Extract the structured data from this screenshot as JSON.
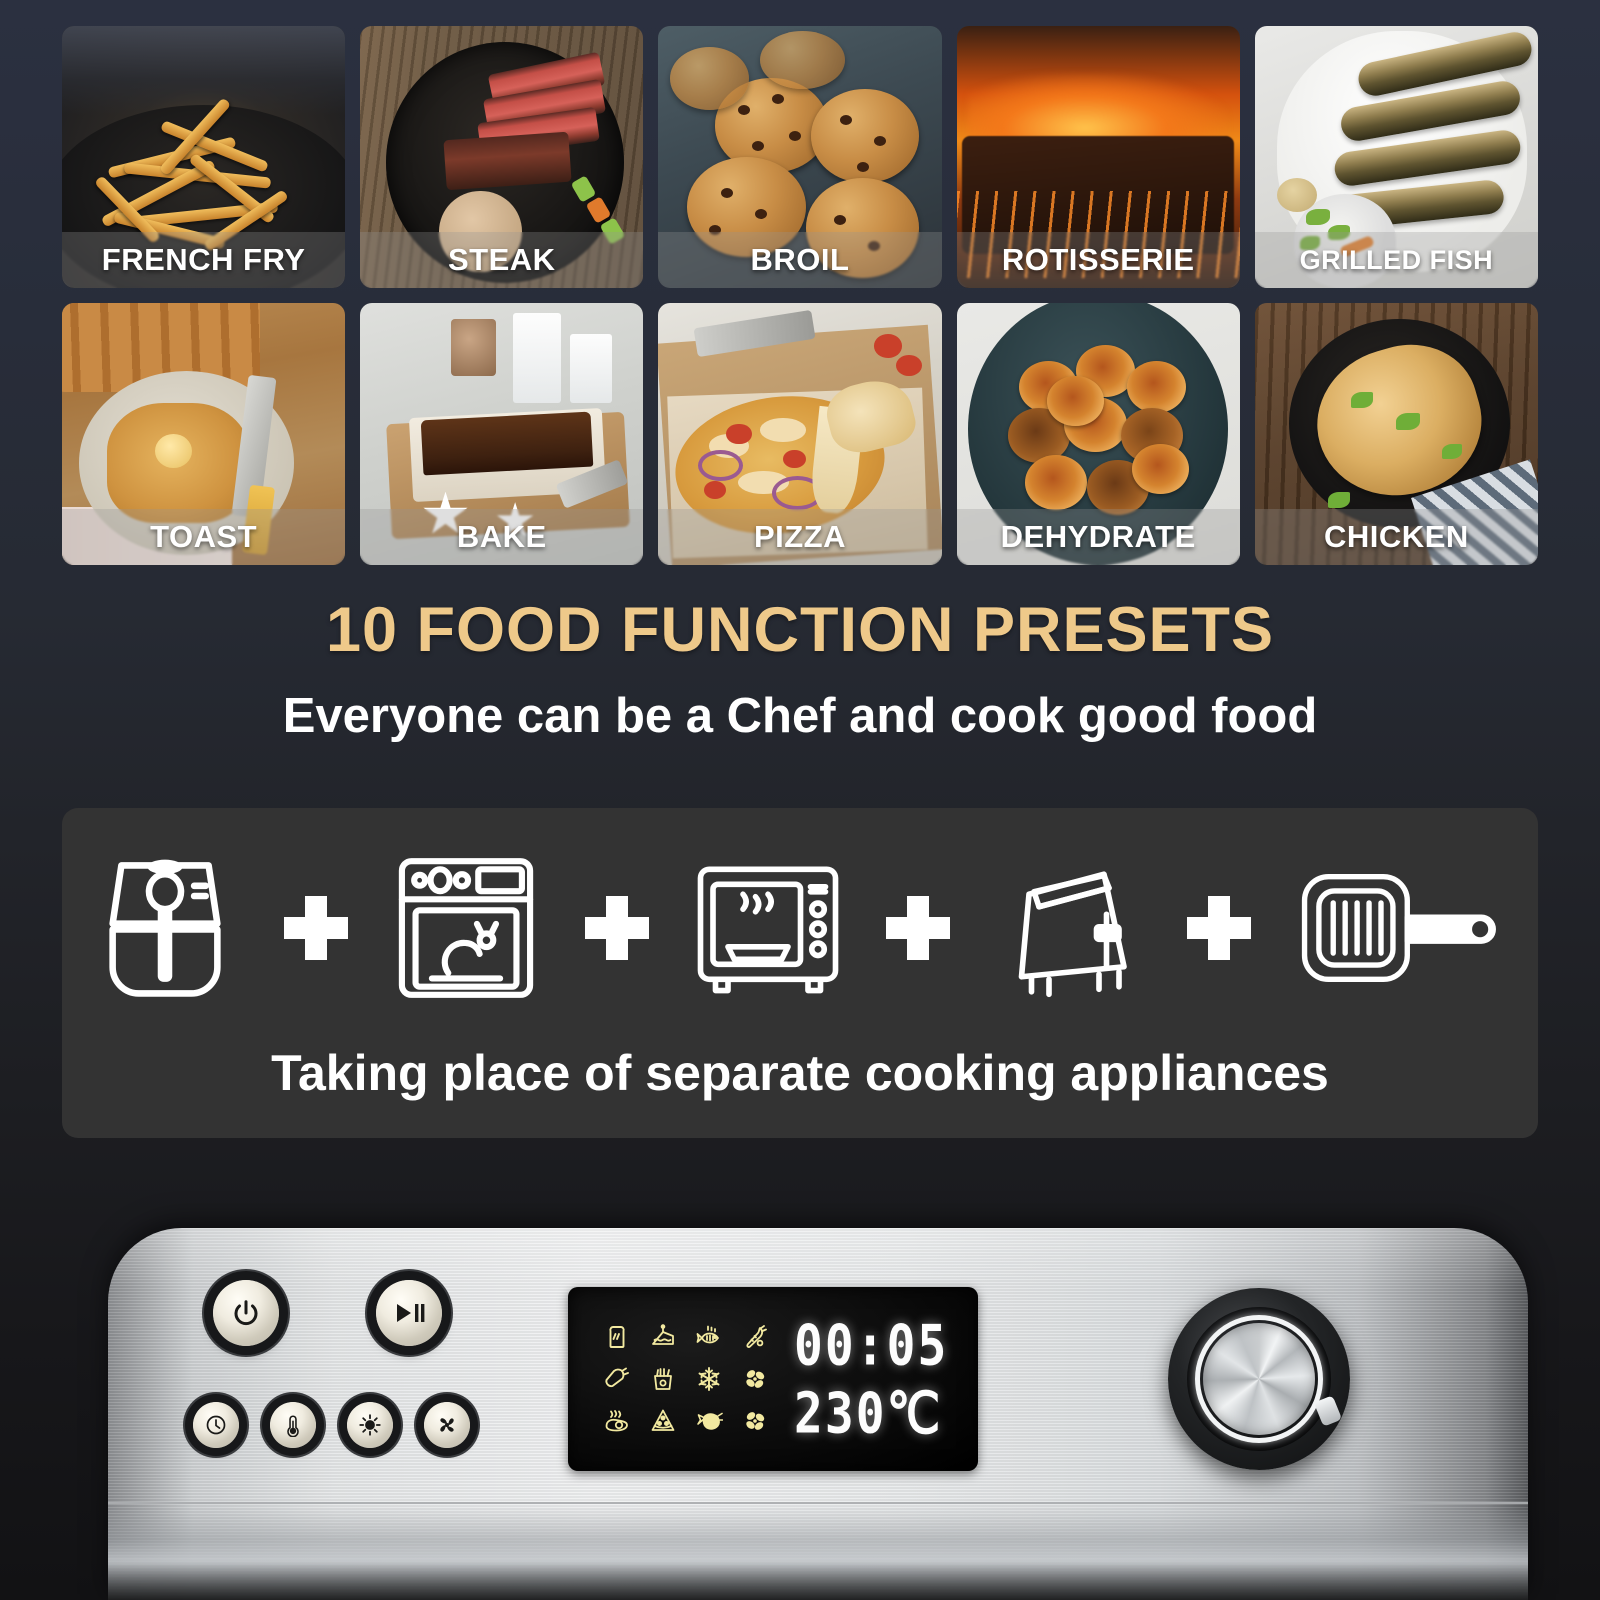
{
  "background": {
    "top_color": "#2b3040",
    "bottom_color": "#121214"
  },
  "presets": {
    "row1": [
      {
        "label": "FRENCH FRY",
        "photo": "french-fries-in-black-pan"
      },
      {
        "label": "STEAK",
        "photo": "sliced-steak-in-cast-iron-skillet"
      },
      {
        "label": "BROIL",
        "photo": "chocolate-chip-cookies-in-tin"
      },
      {
        "label": "ROTISSERIE",
        "photo": "ribs-over-glowing-charcoal-grill"
      },
      {
        "label": "GRILLED FISH",
        "photo": "grilled-sardines-on-white-plate"
      }
    ],
    "row2": [
      {
        "label": "TOAST",
        "photo": "buttered-toast-on-plate"
      },
      {
        "label": "BAKE",
        "photo": "chocolate-loaf-cake-in-tin"
      },
      {
        "label": "PIZZA",
        "photo": "pizza-with-cheese-pull"
      },
      {
        "label": "DEHYDRATE",
        "photo": "dried-orange-slices-on-dark-plate"
      },
      {
        "label": "CHICKEN",
        "photo": "roast-chicken-in-cast-iron-pan"
      }
    ]
  },
  "headline": {
    "title": "10 FOOD FUNCTION PRESETS",
    "title_color": "#eec98a",
    "subtitle": "Everyone can be a Chef and cook good food"
  },
  "appliance_section": {
    "panel_color": "#333333",
    "tagline": "Taking place of separate cooking appliances",
    "icons": [
      {
        "name": "air-fryer-icon"
      },
      {
        "name": "oven-icon"
      },
      {
        "name": "toaster-oven-icon"
      },
      {
        "name": "toaster-icon"
      },
      {
        "name": "grill-pan-icon"
      }
    ],
    "separator": "+"
  },
  "control_panel": {
    "buttons": [
      {
        "name": "power-button",
        "icon": "power-icon",
        "size": "big"
      },
      {
        "name": "play-pause-button",
        "icon": "play-pause-icon",
        "size": "big"
      },
      {
        "name": "timer-button",
        "icon": "clock-icon",
        "size": "small"
      },
      {
        "name": "temperature-button",
        "icon": "thermometer-icon",
        "size": "small"
      },
      {
        "name": "light-button",
        "icon": "light-icon",
        "size": "small"
      },
      {
        "name": "fan-button",
        "icon": "fan-icon",
        "size": "small"
      }
    ],
    "display": {
      "icon_color": "#f2e9a0",
      "digit_color": "#fdfdfd",
      "timer_value": "00:05",
      "temperature_value": "230℃",
      "preset_icons": [
        "toast-icon",
        "cake-icon",
        "fish-icon",
        "carrot-icon",
        "chicken-leg-icon",
        "french-fries-icon",
        "snowflake-icon",
        "fan-icon",
        "fried-egg-icon",
        "pizza-slice-icon",
        "roast-chicken-icon",
        "fan-icon"
      ]
    },
    "knob": {
      "name": "rotary-control-knob"
    }
  }
}
